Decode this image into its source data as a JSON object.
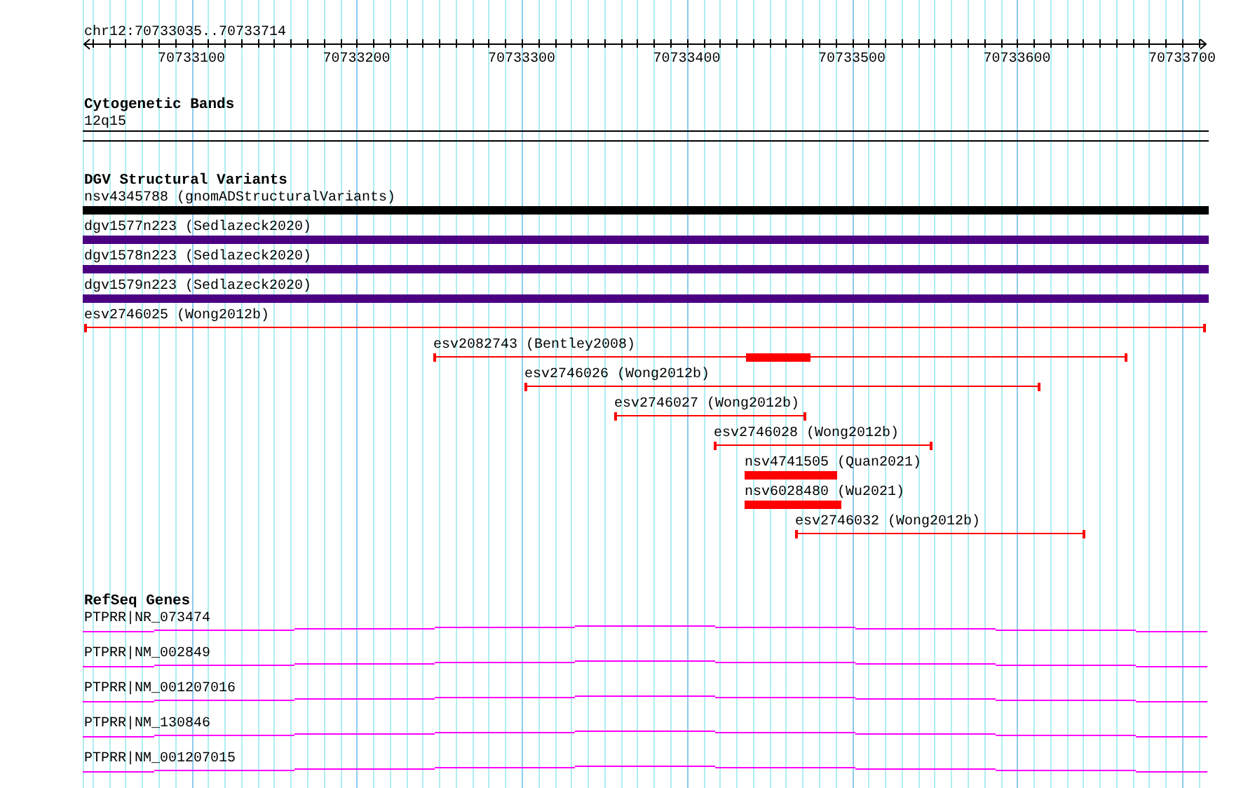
{
  "ruler": {
    "location": "chr12:70733035..70733714",
    "ticks": [
      "70733100",
      "70733200",
      "70733300",
      "70733400",
      "70733500",
      "70733600",
      "70733700"
    ]
  },
  "tracks": [
    {
      "title": "Cytogenetic Bands",
      "kind": "bands",
      "features": [
        {
          "label": "12q15"
        }
      ]
    },
    {
      "title": "DGV Structural Variants",
      "kind": "variants",
      "features": [
        {
          "label": "nsv4345788 (gnomADStructuralVariants)",
          "kind": "bar",
          "color": "#000000"
        },
        {
          "label": "dgv1577n223 (Sedlazeck2020)",
          "kind": "bar",
          "color": "#4b0082"
        },
        {
          "label": "dgv1578n223 (Sedlazeck2020)",
          "kind": "bar",
          "color": "#4b0082"
        },
        {
          "label": "dgv1579n223 (Sedlazeck2020)",
          "kind": "bar",
          "color": "#4b0082"
        },
        {
          "label": "esv2746025 (Wong2012b)",
          "kind": "range",
          "color": "#ff0000"
        },
        {
          "label": "esv2082743 (Bentley2008)",
          "kind": "range",
          "color": "#ff0000"
        },
        {
          "label": "esv2746026 (Wong2012b)",
          "kind": "range",
          "color": "#ff0000"
        },
        {
          "label": "esv2746027 (Wong2012b)",
          "kind": "range",
          "color": "#ff0000"
        },
        {
          "label": "esv2746028 (Wong2012b)",
          "kind": "range",
          "color": "#ff0000"
        },
        {
          "label": "nsv4741505 (Quan2021)",
          "kind": "bar",
          "color": "#ff0000"
        },
        {
          "label": "nsv6028480 (Wu2021)",
          "kind": "bar",
          "color": "#ff0000"
        },
        {
          "label": "esv2746032 (Wong2012b)",
          "kind": "range",
          "color": "#ff0000"
        }
      ]
    },
    {
      "title": "RefSeq Genes",
      "kind": "genes",
      "features": [
        {
          "label": "PTPRR|NR_073474",
          "color": "#ff00ff"
        },
        {
          "label": "PTPRR|NM_002849",
          "color": "#ff00ff"
        },
        {
          "label": "PTPRR|NM_001207016",
          "color": "#ff00ff"
        },
        {
          "label": "PTPRR|NM_130846",
          "color": "#ff00ff"
        },
        {
          "label": "PTPRR|NM_001207015",
          "color": "#ff00ff"
        }
      ]
    }
  ]
}
